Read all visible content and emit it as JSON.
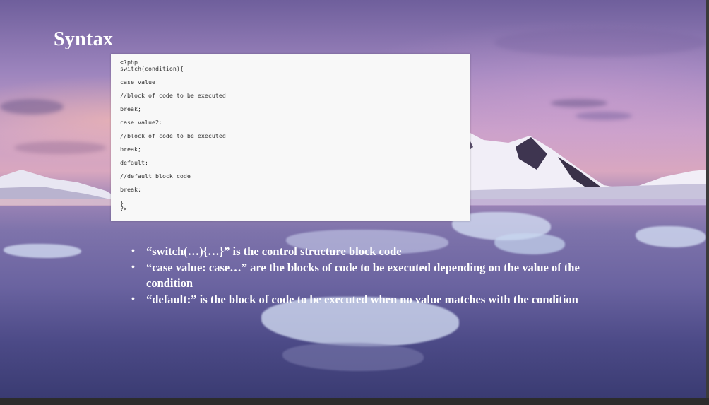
{
  "slide": {
    "title": "Syntax",
    "code_lines": [
      "<?php",
      "switch(condition){",
      "case value:",
      "//block of code to be executed",
      "break;",
      "case value2:",
      "//block of code to be executed",
      "break;",
      "default:",
      "//default block code",
      "break;",
      "}",
      "?>"
    ],
    "bullets": [
      "“switch(…){…}” is the control structure block code",
      "“case value: case…” are the blocks of code to be executed depending on the value of the condition",
      "“default:” is the block of code to be executed when no value matches with the condition"
    ]
  },
  "colors": {
    "title_text": "#ffffff",
    "code_background": "#f8f8f8",
    "code_text": "#333333",
    "bullet_text": "#ffffff"
  }
}
